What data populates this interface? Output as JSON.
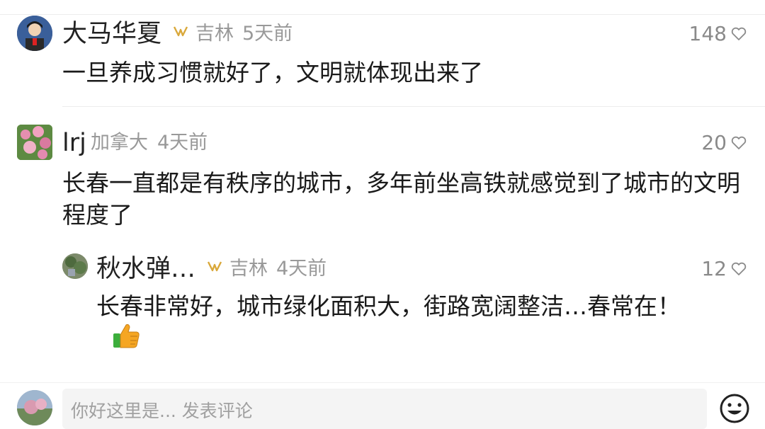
{
  "comments": [
    {
      "name": "大马华夏",
      "location": "吉林",
      "time": "5天前",
      "likes": "148",
      "text": "一旦养成习惯就好了，文明就体现出来了"
    },
    {
      "name": "lrj",
      "location": "加拿大",
      "time": "4天前",
      "likes": "20",
      "text": "长春一直都是有秩序的城市，多年前坐高铁就感觉到了城市的文明程度了"
    },
    {
      "name": "秋水弹…",
      "location": "吉林",
      "time": "4天前",
      "likes": "12",
      "text": "长春非常好，城市绿化面积大，街路宽阔整洁…春常在！"
    }
  ],
  "input": {
    "placeholder": "你好这里是... 发表评论"
  },
  "icons": {
    "badge": "fan-badge-icon",
    "like": "heart-icon",
    "thumb": "thumbs-up-icon",
    "emoji": "emoji-icon"
  },
  "colors": {
    "badge": "#d9a83a",
    "meta": "#999999",
    "thumb": "#f5a623"
  }
}
